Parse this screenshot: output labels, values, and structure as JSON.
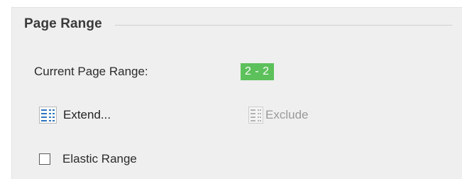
{
  "group": {
    "title": "Page Range"
  },
  "current_range": {
    "label": "Current Page Range:",
    "value": "2 - 2"
  },
  "actions": {
    "extend_label": "Extend...",
    "exclude_label": "Exclude"
  },
  "elastic": {
    "label": "Elastic Range",
    "checked": false
  },
  "colors": {
    "badge": "#5cc15a",
    "panel_bg": "#efefef",
    "icon_blue": "#2f74c0"
  }
}
